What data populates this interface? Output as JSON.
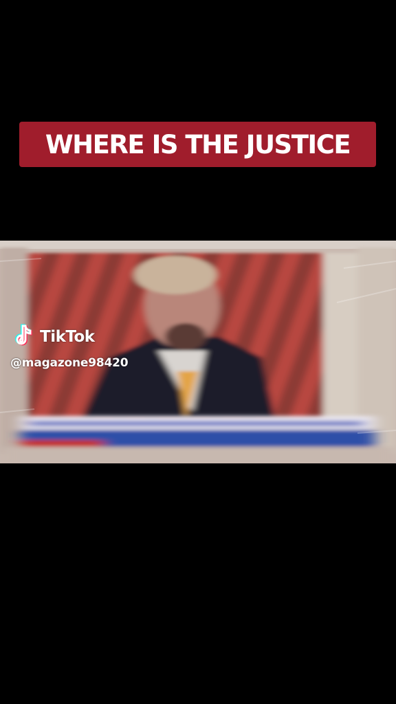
{
  "overlay_caption": {
    "text": "WHERE IS THE JUSTICE",
    "background_color": "#a01d2c",
    "text_color": "#ffffff"
  },
  "video": {
    "description_icon": "blurred-news-broadcast-frame"
  },
  "watermark": {
    "brand": "TikTok",
    "handle": "@magazone98420",
    "icon": "tiktok-logo-icon",
    "colors": {
      "cyan": "#25f4ee",
      "red": "#fe2c55",
      "white": "#ffffff"
    }
  }
}
